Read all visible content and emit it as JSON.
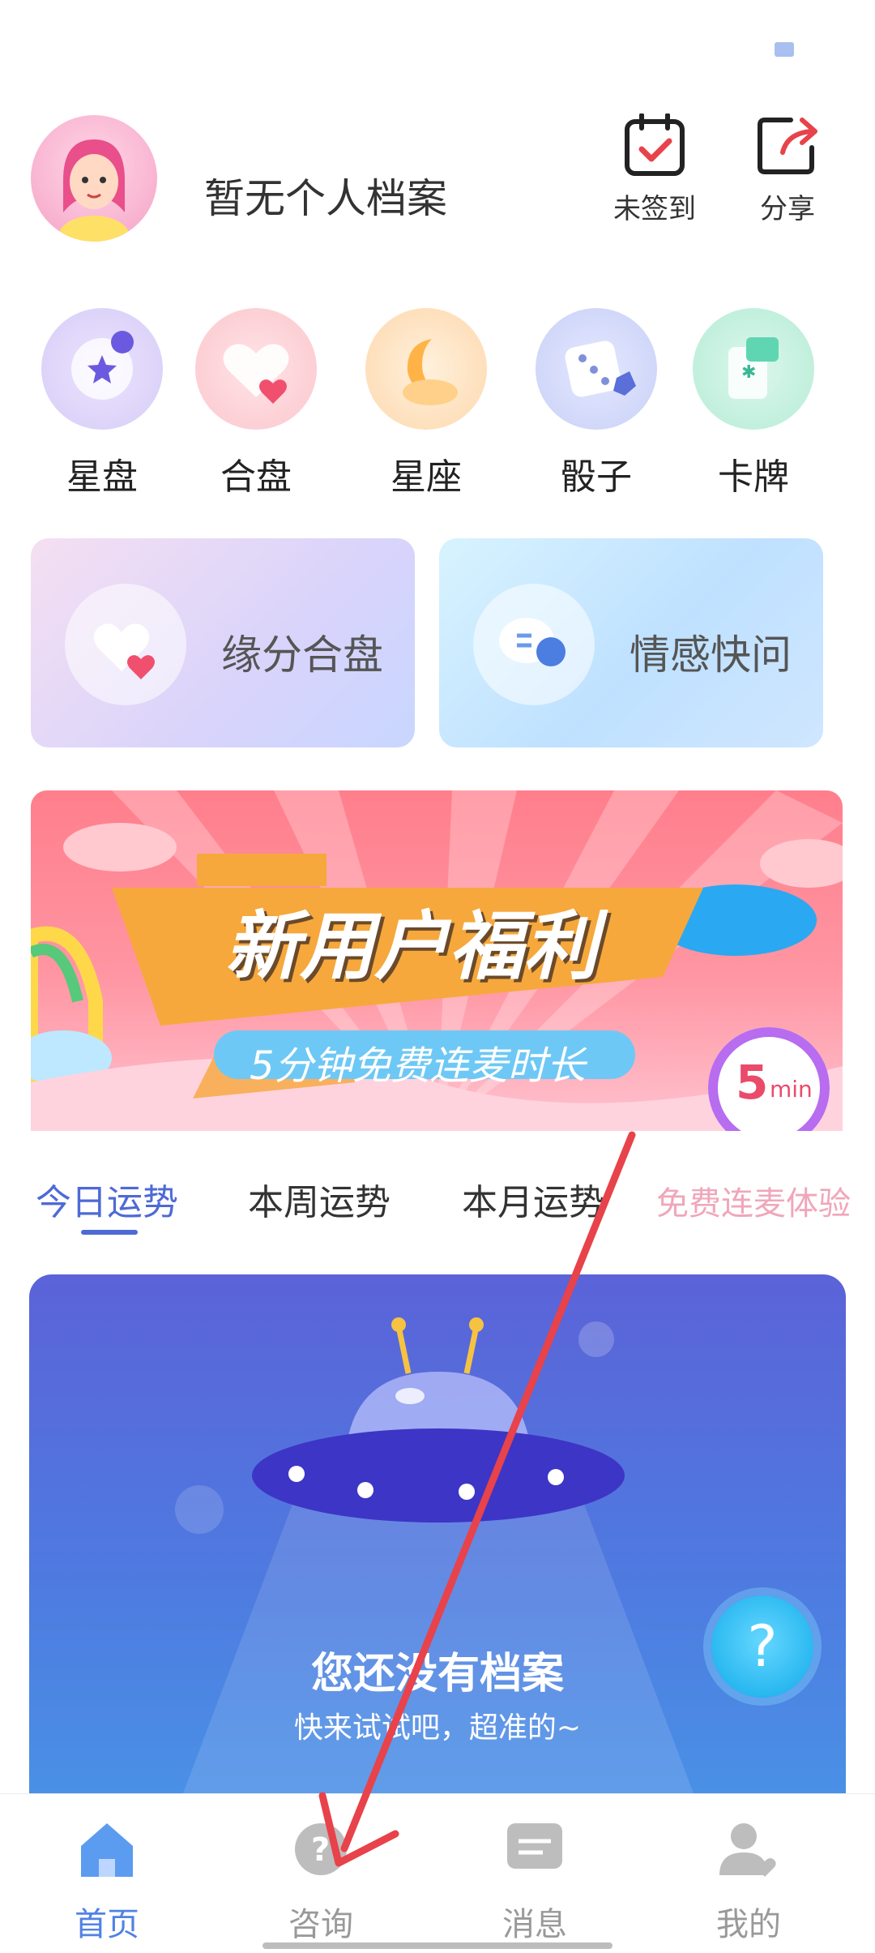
{
  "header": {
    "profile_title": "暂无个人档案",
    "checkin_label": "未签到",
    "share_label": "分享"
  },
  "categories": [
    {
      "label": "星盘",
      "icon": "star-chart-icon"
    },
    {
      "label": "合盘",
      "icon": "heart-match-icon"
    },
    {
      "label": "星座",
      "icon": "moon-cloud-icon"
    },
    {
      "label": "骰子",
      "icon": "dice-icon"
    },
    {
      "label": "卡牌",
      "icon": "tarot-card-icon"
    }
  ],
  "cards": {
    "match": {
      "label": "缘分合盘",
      "icon": "heart-match-icon"
    },
    "ask": {
      "label": "情感快问",
      "icon": "chat-bubble-icon"
    }
  },
  "banner": {
    "title": "新用户福利",
    "subtitle": "5分钟免费连麦时长",
    "badge_number": "5",
    "badge_unit": "min"
  },
  "tabs": [
    "今日运势",
    "本周运势",
    "本月运势"
  ],
  "side_promo": "免费连麦体验",
  "fortune": {
    "title": "您还没有档案",
    "subtitle": "快来试试吧，超准的~"
  },
  "help_label": "?",
  "bottom_nav": [
    {
      "label": "首页",
      "icon": "home-icon",
      "active": true
    },
    {
      "label": "咨询",
      "icon": "question-chat-icon",
      "active": false
    },
    {
      "label": "消息",
      "icon": "message-icon",
      "active": false
    },
    {
      "label": "我的",
      "icon": "profile-icon",
      "active": false
    }
  ],
  "colors": {
    "accent": "#4e6ad6",
    "nav_active": "#4f82e6",
    "arrow": "#e8424a"
  }
}
